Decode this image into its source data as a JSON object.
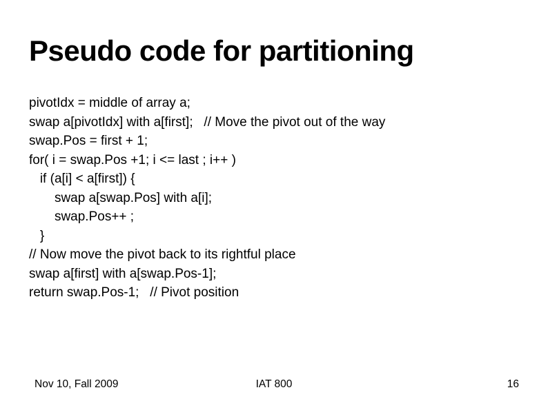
{
  "title": "Pseudo code for partitioning",
  "code": {
    "l1": "pivotIdx = middle of array a;",
    "l2": "swap a[pivotIdx] with a[first];   // Move the pivot out of the way",
    "l3": "swap.Pos = first + 1;",
    "l4": "for( i = swap.Pos +1; i <= last ; i++ )",
    "l5": "   if (a[i] < a[first]) {",
    "l6": "       swap a[swap.Pos] with a[i];",
    "l7": "       swap.Pos++ ;",
    "l8": "   }",
    "l9": "// Now move the pivot back to its rightful place",
    "l10": "swap a[first] with a[swap.Pos-1];",
    "l11": "return swap.Pos-1;   // Pivot position"
  },
  "footer": {
    "date": "Nov 10, Fall 2009",
    "course": "IAT 800",
    "page": "16"
  }
}
